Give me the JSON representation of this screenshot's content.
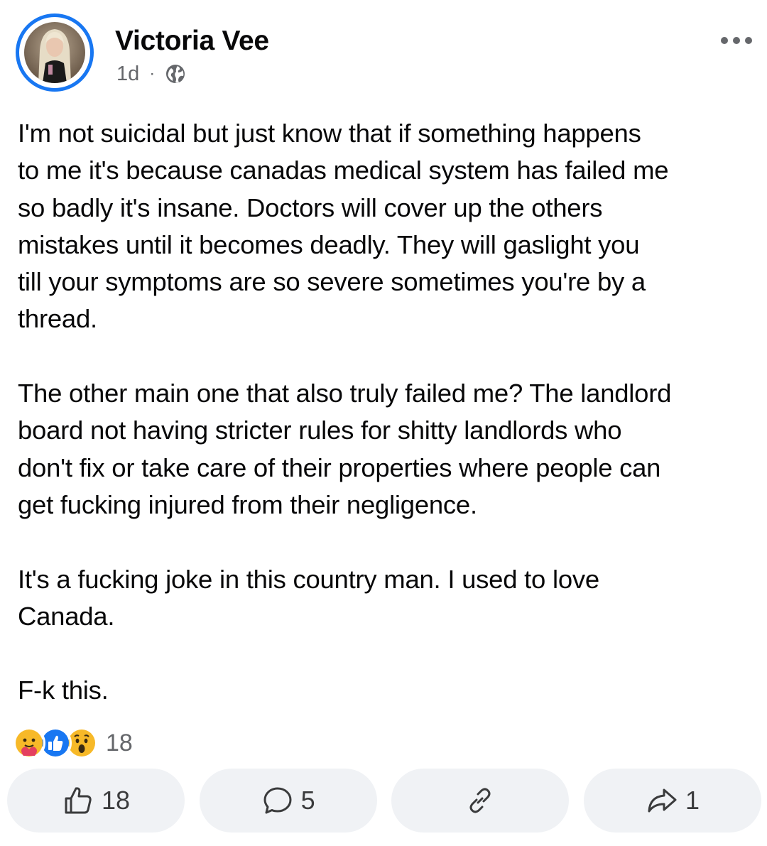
{
  "post": {
    "author": "Victoria Vee",
    "time": "1d",
    "separator": "·",
    "audience_icon": "globe-icon",
    "menu_icon": "more-options-icon",
    "paragraphs": [
      "I'm not suicidal but just know that if something happens\nto me it's because canadas medical system has failed me\nso badly it's insane. Doctors will cover up the others\nmistakes until it becomes deadly. They will gaslight you\ntill your symptoms are so severe sometimes you're by a\nthread.",
      "The other main one that also truly failed me? The landlord\nboard not having stricter rules for shitty landlords who\ndon't fix or take care of their properties where people can\nget fucking injured from their negligence.",
      "It's a fucking joke in this country man. I used to love\nCanada.",
      "F-k this."
    ]
  },
  "reactions": {
    "icons": [
      "care-reaction-icon",
      "like-reaction-icon",
      "wow-reaction-icon"
    ],
    "count": "18"
  },
  "actions": {
    "like": {
      "icon": "thumbs-up-icon",
      "count": "18"
    },
    "comment": {
      "icon": "comment-bubble-icon",
      "count": "5"
    },
    "copy_link": {
      "icon": "link-icon",
      "count": ""
    },
    "share": {
      "icon": "share-arrow-icon",
      "count": "1"
    }
  },
  "colors": {
    "accent": "#1877f2",
    "text": "#080809",
    "secondary_text": "#65676b",
    "button_bg": "#f0f2f5",
    "like_reaction": "#1877f2",
    "wow_reaction": "#f7b928"
  }
}
